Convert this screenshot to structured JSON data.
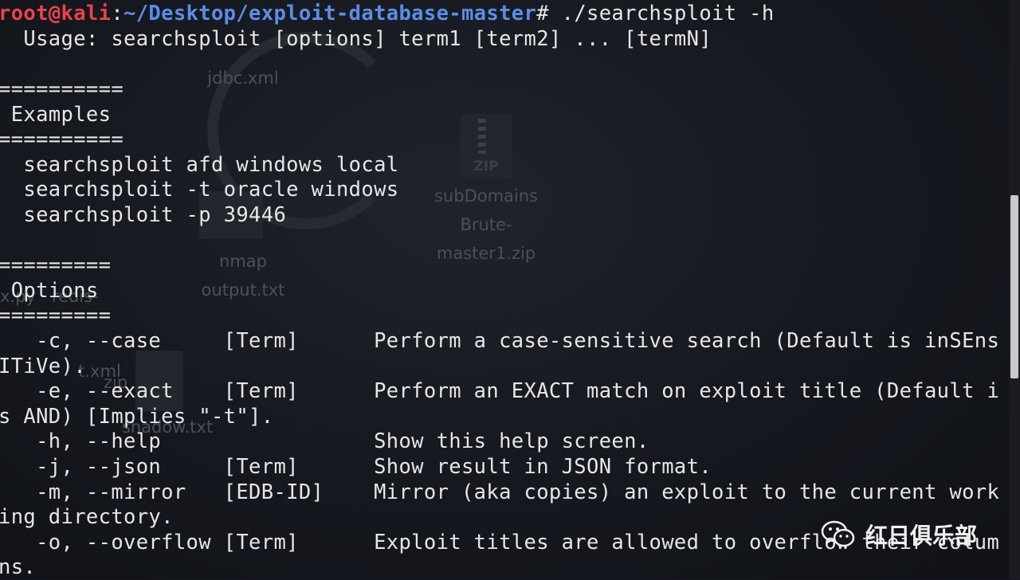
{
  "prompt": {
    "user": "root@kali",
    "separator": ":",
    "path": "~/Desktop/exploit-database-master",
    "symbol": "# ",
    "command": "./searchsploit -h"
  },
  "lines": [
    "  Usage: searchsploit [options] term1 [term2] ... [termN]",
    "",
    "==========",
    " Examples",
    "==========",
    "  searchsploit afd windows local",
    "  searchsploit -t oracle windows",
    "  searchsploit -p 39446",
    "",
    "=========",
    " Options",
    "=========",
    "   -c, --case     [Term]      Perform a case-sensitive search (Default is inSEns",
    "ITiVe).",
    "   -e, --exact    [Term]      Perform an EXACT match on exploit title (Default i",
    "s AND) [Implies \"-t\"].",
    "   -h, --help                 Show this help screen.",
    "   -j, --json     [Term]      Show result in JSON format.",
    "   -m, --mirror   [EDB-ID]    Mirror (aka copies) an exploit to the current work",
    "ing directory.",
    "   -o, --overflow [Term]      Exploit titles are allowed to overflow their colum",
    "ns."
  ],
  "desktop_icons": {
    "jdbc": "jdbc.xml",
    "zip_badge": "ZIP",
    "subdomains": [
      "subDomains",
      "Brute-",
      "master1.zip"
    ],
    "nmap": [
      "nmap",
      "output.txt"
    ],
    "redis": [
      "x.py   redis-",
      "zip"
    ],
    "xml2": "t.xml",
    "shadow": "shadow.txt"
  },
  "watermark": {
    "text": "红日俱乐部",
    "icon": "wechat-icon"
  },
  "colors": {
    "background": "#14171d",
    "text": "#e6e6e6",
    "prompt_user": "#e8434a",
    "prompt_path": "#5b8de8",
    "scrollbar_thumb": "#c9c9c9"
  }
}
